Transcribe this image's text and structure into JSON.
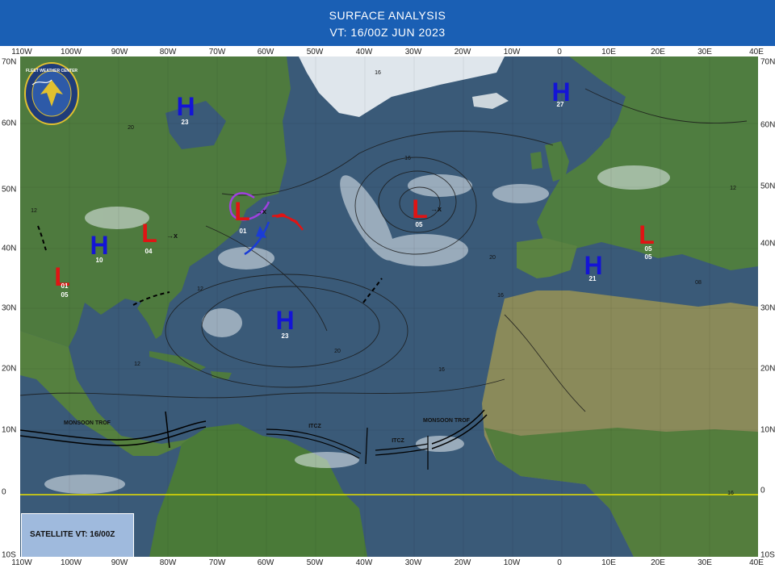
{
  "title": "SURFACE ANALYSIS",
  "valid_time": "VT: 16/00Z JUN 2023",
  "satellite_label": "SATELLITE VT: 16/00Z",
  "lon_labels": [
    "110W",
    "100W",
    "90W",
    "80W",
    "70W",
    "60W",
    "50W",
    "40W",
    "30W",
    "20W",
    "10W",
    "0",
    "10E",
    "20E",
    "30E",
    "40E"
  ],
  "lat_labels_left": [
    "70N",
    "60N",
    "50N",
    "40N",
    "30N",
    "20N",
    "10N",
    "0",
    "10S"
  ],
  "lat_labels_right": [
    "60N",
    "50N",
    "40N",
    "30N",
    "20N",
    "10N",
    "0",
    "10S"
  ],
  "logo_text": "FLEET WEATHER CENTER",
  "colors": {
    "header": "#1a5fb4",
    "high": "#1414d6",
    "low": "#e01414",
    "equator": "#e8e000",
    "ocean": "#3a5a78",
    "land": "#4e7a3e",
    "desert": "#8a8a5a"
  },
  "pressure_systems": [
    {
      "type": "H",
      "value": "23"
    },
    {
      "type": "H",
      "value": "27"
    },
    {
      "type": "H",
      "value": "10"
    },
    {
      "type": "L",
      "value": "04"
    },
    {
      "type": "L",
      "value": "01"
    },
    {
      "type": "L",
      "value": "05"
    },
    {
      "type": "L",
      "value": "01",
      "value2": "05"
    },
    {
      "type": "H",
      "value": "23"
    },
    {
      "type": "H",
      "value": "21"
    },
    {
      "type": "L",
      "value": "05",
      "value2": "05"
    }
  ],
  "features": [
    "MONSOON TROF",
    "ITCZ",
    "ITCZ",
    "MONSOON TROF"
  ],
  "isobar_labels": [
    "16",
    "20",
    "12",
    "16",
    "16",
    "20",
    "12",
    "20",
    "16",
    "12",
    "16",
    "12",
    "08"
  ]
}
